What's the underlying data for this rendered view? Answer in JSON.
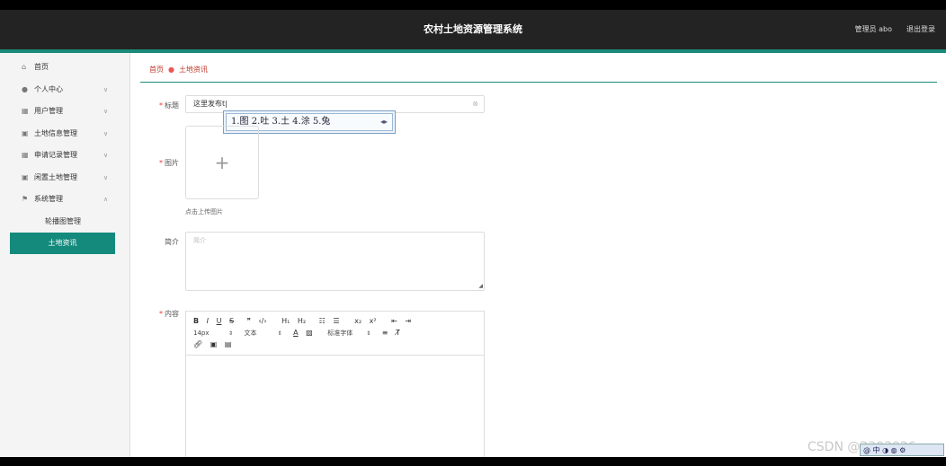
{
  "header": {
    "title": "农村土地资源管理系统",
    "user_label": "管理员 abo",
    "logout_label": "退出登录"
  },
  "sidebar": {
    "items": [
      {
        "label": "首页",
        "icon": "home-icon",
        "has_chevron": false
      },
      {
        "label": "个人中心",
        "icon": "user-icon",
        "has_chevron": true
      },
      {
        "label": "用户管理",
        "icon": "grid-icon",
        "has_chevron": true
      },
      {
        "label": "土地信息管理",
        "icon": "building-icon",
        "has_chevron": true
      },
      {
        "label": "申请记录管理",
        "icon": "grid-icon",
        "has_chevron": true
      },
      {
        "label": "闲置土地管理",
        "icon": "building-icon",
        "has_chevron": true
      },
      {
        "label": "系统管理",
        "icon": "flag-icon",
        "has_chevron": true
      }
    ],
    "sub_item": "轮播图管理",
    "active_item": "土地资讯"
  },
  "breadcrumb": {
    "home": "首页",
    "current": "土地资讯"
  },
  "form": {
    "title_label": "标题",
    "title_value": "这里发布t|",
    "image_label": "图片",
    "upload_plus": "+",
    "upload_hint": "点击上传图片",
    "intro_label": "简介",
    "intro_placeholder": "简介",
    "content_label": "内容"
  },
  "ime": {
    "candidates": "1.图 2.吐 3.土 4.涂 5.兔"
  },
  "editor": {
    "font_size": "14px",
    "text_type": "文本",
    "font_family": "标准字体"
  },
  "watermark": "CSDN @2303026",
  "colors": {
    "accent": "#138a7c",
    "topbar": "#232323",
    "breadcrumb": "#c0392b"
  }
}
